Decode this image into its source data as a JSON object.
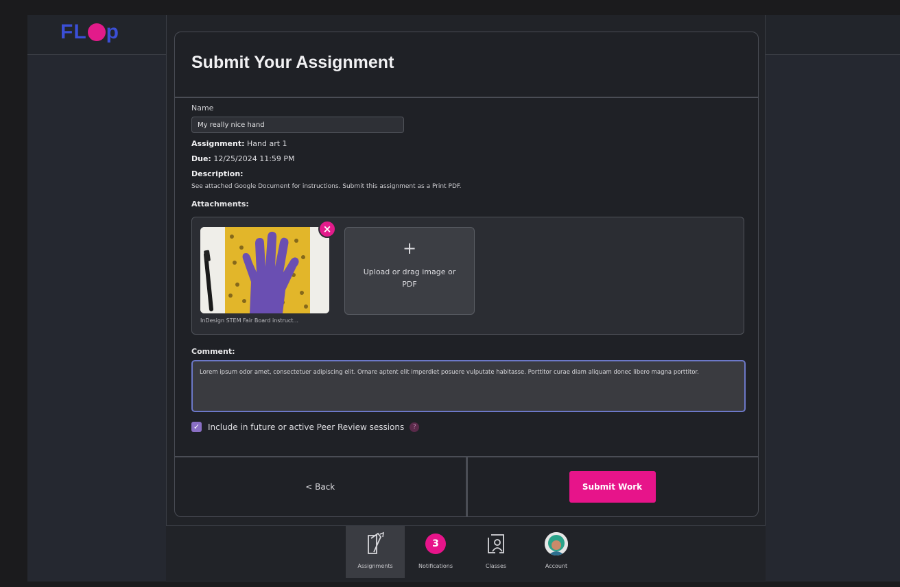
{
  "app": {
    "logo_text": "FL",
    "logo_tail": "p"
  },
  "modal": {
    "title": "Submit Your Assignment",
    "name_label": "Name",
    "name_value": "My really nice hand",
    "assignment_label": "Assignment:",
    "assignment_value": "Hand art 1",
    "due_label": "Due:",
    "due_value": "12/25/2024 11:59 PM",
    "description_label": "Description:",
    "description_text": "See attached Google Document for instructions. Submit this assignment as a Print PDF.",
    "attachments_label": "Attachments:",
    "attachment_caption": "InDesign STEM Fair Board instruct...",
    "upload_plus": "+",
    "upload_text": "Upload or drag image or PDF",
    "comment_label": "Comment:",
    "comment_text": "Lorem ipsum odor amet, consectetuer adipiscing elit. Ornare aptent elit imperdiet posuere vulputate habitasse. Porttitor curae diam aliquam donec libero magna porttitor.",
    "peer_review_label": "Include in future or active Peer Review sessions",
    "back_label": "< Back",
    "submit_label": "Submit Work"
  },
  "nav": {
    "assignments": "Assignments",
    "notifications": "Notifications",
    "notifications_count": "3",
    "classes": "Classes",
    "account": "Account"
  },
  "colors": {
    "accent": "#e7148a",
    "brand_blue": "#3b4fd6",
    "focus": "#6c78c8"
  }
}
